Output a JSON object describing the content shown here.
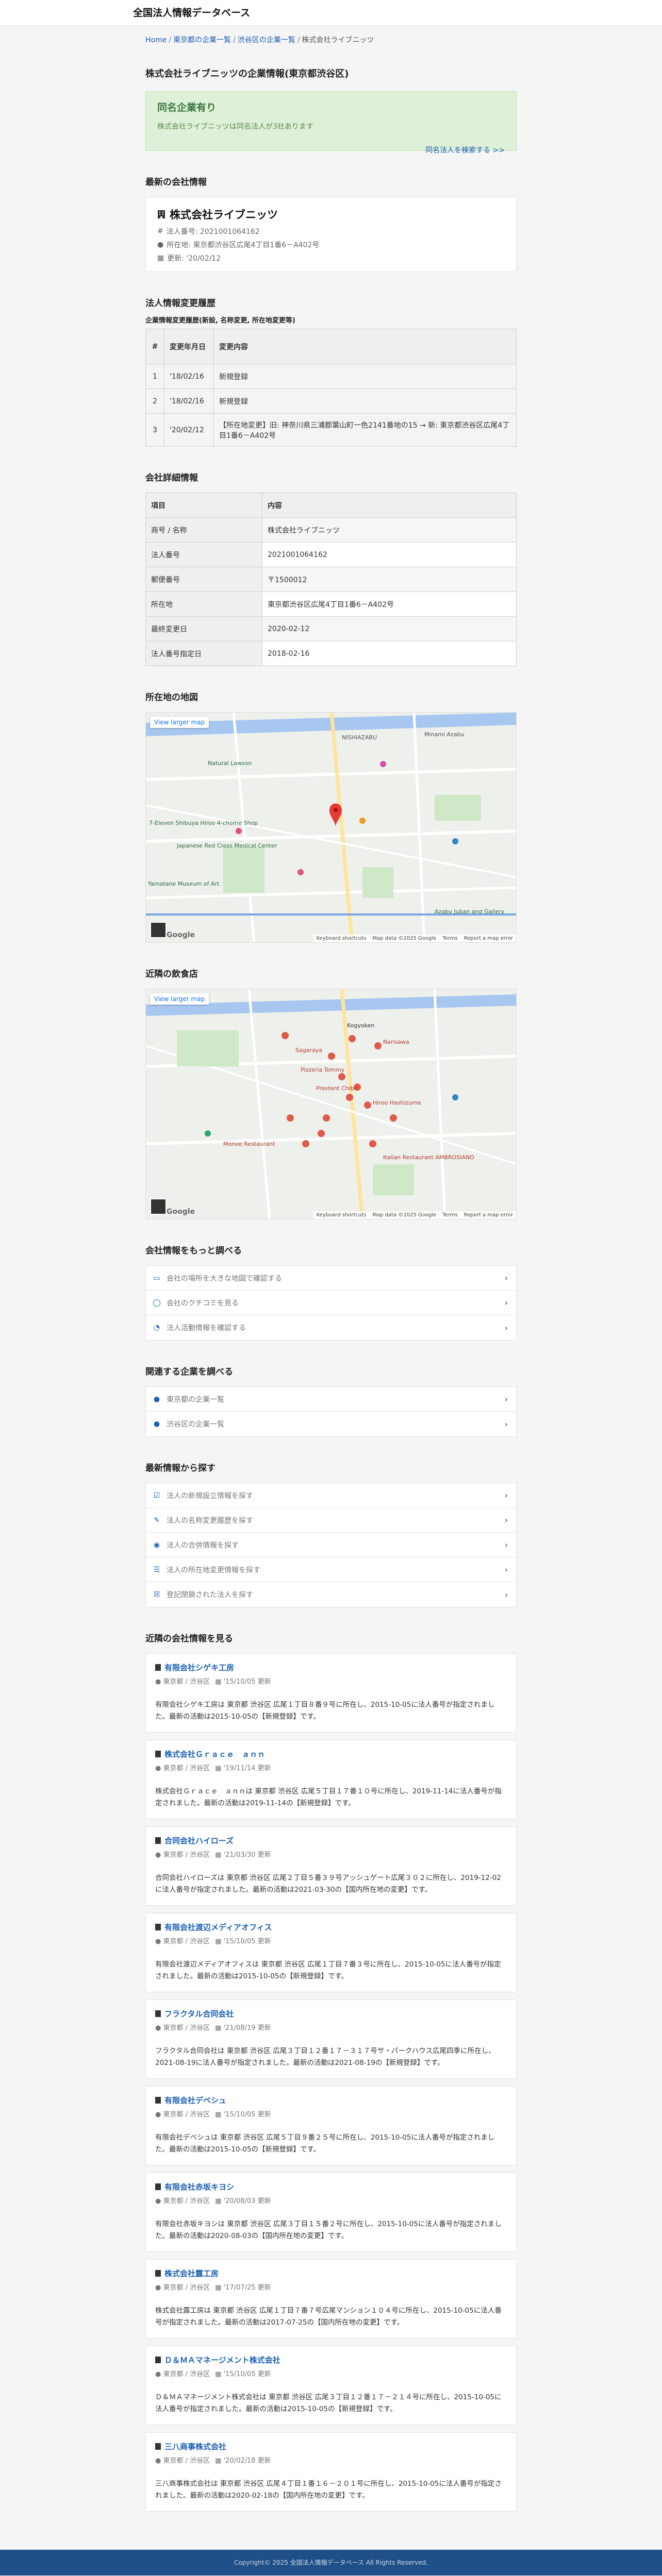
{
  "site_title": "全国法人情報データベース",
  "breadcrumb": {
    "home": "Home",
    "pref": "東京都の企業一覧",
    "city": "渋谷区の企業一覧",
    "current": "株式会社ライブニッツ"
  },
  "page_title": "株式会社ライブニッツの企業情報(東京都渋谷区)",
  "same_name": {
    "title": "同名企業有り",
    "desc": "株式会社ライブニッツは同名法人が3社あります",
    "link": "同名法人を検索する >>"
  },
  "latest": {
    "heading": "最新の会社情報",
    "name": "株式会社ライブニッツ",
    "number": "法人番号: 2021001064162",
    "address": "所在地: 東京都渋谷区広尾4丁目1番6－A402号",
    "date": "更新: '20/02/12"
  },
  "history": {
    "heading": "法人情報変更履歴",
    "caption": "企業情報変更履歴(新設, 名称変更, 所在地変更等)",
    "headers": [
      "#",
      "変更年月日",
      "変更内容"
    ],
    "rows": [
      {
        "no": "1",
        "date": "'18/02/16",
        "content": "新規登録"
      },
      {
        "no": "2",
        "date": "'18/02/16",
        "content": "新規登録"
      },
      {
        "no": "3",
        "date": "'20/02/12",
        "content": "【所在地変更】旧: 神奈川県三浦郡葉山町一色2141番地の15 → 新: 東京都渋谷区広尾4丁目1番6－A402号"
      }
    ]
  },
  "details": {
    "heading": "会社詳細情報",
    "headers": [
      "項目",
      "内容"
    ],
    "rows": [
      {
        "k": "商号 / 名称",
        "v": "株式会社ライブニッツ"
      },
      {
        "k": "法人番号",
        "v": "2021001064162"
      },
      {
        "k": "郵便番号",
        "v": "〒1500012"
      },
      {
        "k": "所在地",
        "v": "東京都渋谷区広尾4丁目1番6－A402号"
      },
      {
        "k": "最終変更日",
        "v": "2020-02-12"
      },
      {
        "k": "法人番号指定日",
        "v": "2018-02-16"
      }
    ]
  },
  "map1": {
    "heading": "所在地の地図",
    "view_larger": "View larger map",
    "footer": [
      "Keyboard shortcuts",
      "Map data ©2025 Google",
      "Terms",
      "Report a map error"
    ],
    "logo": "Google",
    "labels": [
      "Natural Lawson",
      "7-Eleven Shibuya Hiroo 4-chome Shop",
      "Japanese Red Cross Medical Center",
      "Yamatane Museum of Art",
      "NISHIAZABU",
      "Minami Azabu",
      "Azabu Juban and Gallery"
    ]
  },
  "map2": {
    "heading": "近隣の飲食店",
    "view_larger": "View larger map",
    "footer": [
      "Keyboard shortcuts",
      "Map data ©2025 Google",
      "Terms",
      "Report a map error"
    ],
    "logo": "Google",
    "labels": [
      "Sagaraya",
      "Kogyoken",
      "Narisawa",
      "Pizzeria Tommy",
      "Prestent Chibo",
      "Hiroo Hashizume",
      "Monoe Restaurant",
      "Italian Restaurant AMBROSIANO"
    ]
  },
  "more": {
    "heading": "会社情報をもっと調べる",
    "items": [
      {
        "icon": "map-icon",
        "glyph": "▭",
        "label": "会社の場所を大きな地図で確認する"
      },
      {
        "icon": "comment-icon",
        "glyph": "◯",
        "label": "会社のクチコミを見る"
      },
      {
        "icon": "chart-pie-icon",
        "glyph": "◔",
        "label": "法人活動情報を確認する"
      }
    ]
  },
  "related": {
    "heading": "関連する企業を調べる",
    "items": [
      {
        "icon": "location-pin-icon",
        "glyph": "●",
        "label": "東京都の企業一覧"
      },
      {
        "icon": "location-pin-icon",
        "glyph": "●",
        "label": "渋谷区の企業一覧"
      }
    ]
  },
  "latest_search": {
    "heading": "最新情報から探す",
    "items": [
      {
        "icon": "checkbox-icon",
        "glyph": "☑",
        "label": "法人の新規設立情報を探す"
      },
      {
        "icon": "edit-icon",
        "glyph": "✎",
        "label": "法人の名称変更履歴を探す"
      },
      {
        "icon": "eye-icon",
        "glyph": "◉",
        "label": "法人の合併情報を探す"
      },
      {
        "icon": "sign-icon",
        "glyph": "☰",
        "label": "法人の所在地変更情報を探す"
      },
      {
        "icon": "window-close-icon",
        "glyph": "☒",
        "label": "登記閉鎖された法人を探す"
      }
    ]
  },
  "nearby": {
    "heading": "近隣の会社情報を見る",
    "items": [
      {
        "name": "有限会社シゲキ工房",
        "loc": "東京都 / 渋谷区",
        "date": "'15/10/05 更新",
        "desc": "有限会社シゲキ工房は 東京都 渋谷区 広尾１丁目８番９号に所在し、2015-10-05に法人番号が指定されました。最新の活動は2015-10-05の【新規登録】です。"
      },
      {
        "name": "株式会社Ｇｒａｃｅ　ａｎｎ",
        "loc": "東京都 / 渋谷区",
        "date": "'19/11/14 更新",
        "desc": "株式会社Ｇｒａｃｅ　ａｎｎは 東京都 渋谷区 広尾５丁目１７番１０号に所在し、2019-11-14に法人番号が指定されました。最新の活動は2019-11-14の【新規登録】です。"
      },
      {
        "name": "合同会社ハイローズ",
        "loc": "東京都 / 渋谷区",
        "date": "'21/03/30 更新",
        "desc": "合同会社ハイローズは 東京都 渋谷区 広尾２丁目５番３９号アッシュゲート広尾３０２に所在し、2019-12-02に法人番号が指定されました。最新の活動は2021-03-30の【国内所在地の変更】です。"
      },
      {
        "name": "有限会社渡辺メディアオフィス",
        "loc": "東京都 / 渋谷区",
        "date": "'15/10/05 更新",
        "desc": "有限会社渡辺メディアオフィスは 東京都 渋谷区 広尾１丁目７番３号に所在し、2015-10-05に法人番号が指定されました。最新の活動は2015-10-05の【新規登録】です。"
      },
      {
        "name": "フラクタル合同会社",
        "loc": "東京都 / 渋谷区",
        "date": "'21/08/19 更新",
        "desc": "フラクタル合同会社は 東京都 渋谷区 広尾３丁目１２番１７－３１７号サ・パークハウス広尾四季に所在し、2021-08-19に法人番号が指定されました。最新の活動は2021-08-19の【新規登録】です。"
      },
      {
        "name": "有限会社デベシュ",
        "loc": "東京都 / 渋谷区",
        "date": "'15/10/05 更新",
        "desc": "有限会社デベシュは 東京都 渋谷区 広尾５丁目９番２５号に所在し、2015-10-05に法人番号が指定されました。最新の活動は2015-10-05の【新規登録】です。"
      },
      {
        "name": "有限会社赤坂キヨシ",
        "loc": "東京都 / 渋谷区",
        "date": "'20/08/03 更新",
        "desc": "有限会社赤坂キヨシは 東京都 渋谷区 広尾３丁目１５番２号に所在し、2015-10-05に法人番号が指定されました。最新の活動は2020-08-03の【国内所在地の変更】です。"
      },
      {
        "name": "株式会社露工房",
        "loc": "東京都 / 渋谷区",
        "date": "'17/07/25 更新",
        "desc": "株式会社露工房は 東京都 渋谷区 広尾１丁目７番７号広尾マンション１０４号に所在し、2015-10-05に法人番号が指定されました。最新の活動は2017-07-25の【国内所在地の変更】です。"
      },
      {
        "name": "Ｄ＆ＭＡマネージメント株式会社",
        "loc": "東京都 / 渋谷区",
        "date": "'15/10/05 更新",
        "desc": "Ｄ＆ＭＡマネージメント株式会社は 東京都 渋谷区 広尾３丁目１２番１７－２１４号に所在し、2015-10-05に法人番号が指定されました。最新の活動は2015-10-05の【新規登録】です。"
      },
      {
        "name": "三八商事株式会社",
        "loc": "東京都 / 渋谷区",
        "date": "'20/02/18 更新",
        "desc": "三八商事株式会社は 東京都 渋谷区 広尾４丁目１番１６－２０１号に所在し、2015-10-05に法人番号が指定されました。最新の活動は2020-02-18の【国内所在地の変更】です。"
      }
    ]
  },
  "footer": "Copyright© 2025 全国法人情報データベース All Rights Reserved."
}
